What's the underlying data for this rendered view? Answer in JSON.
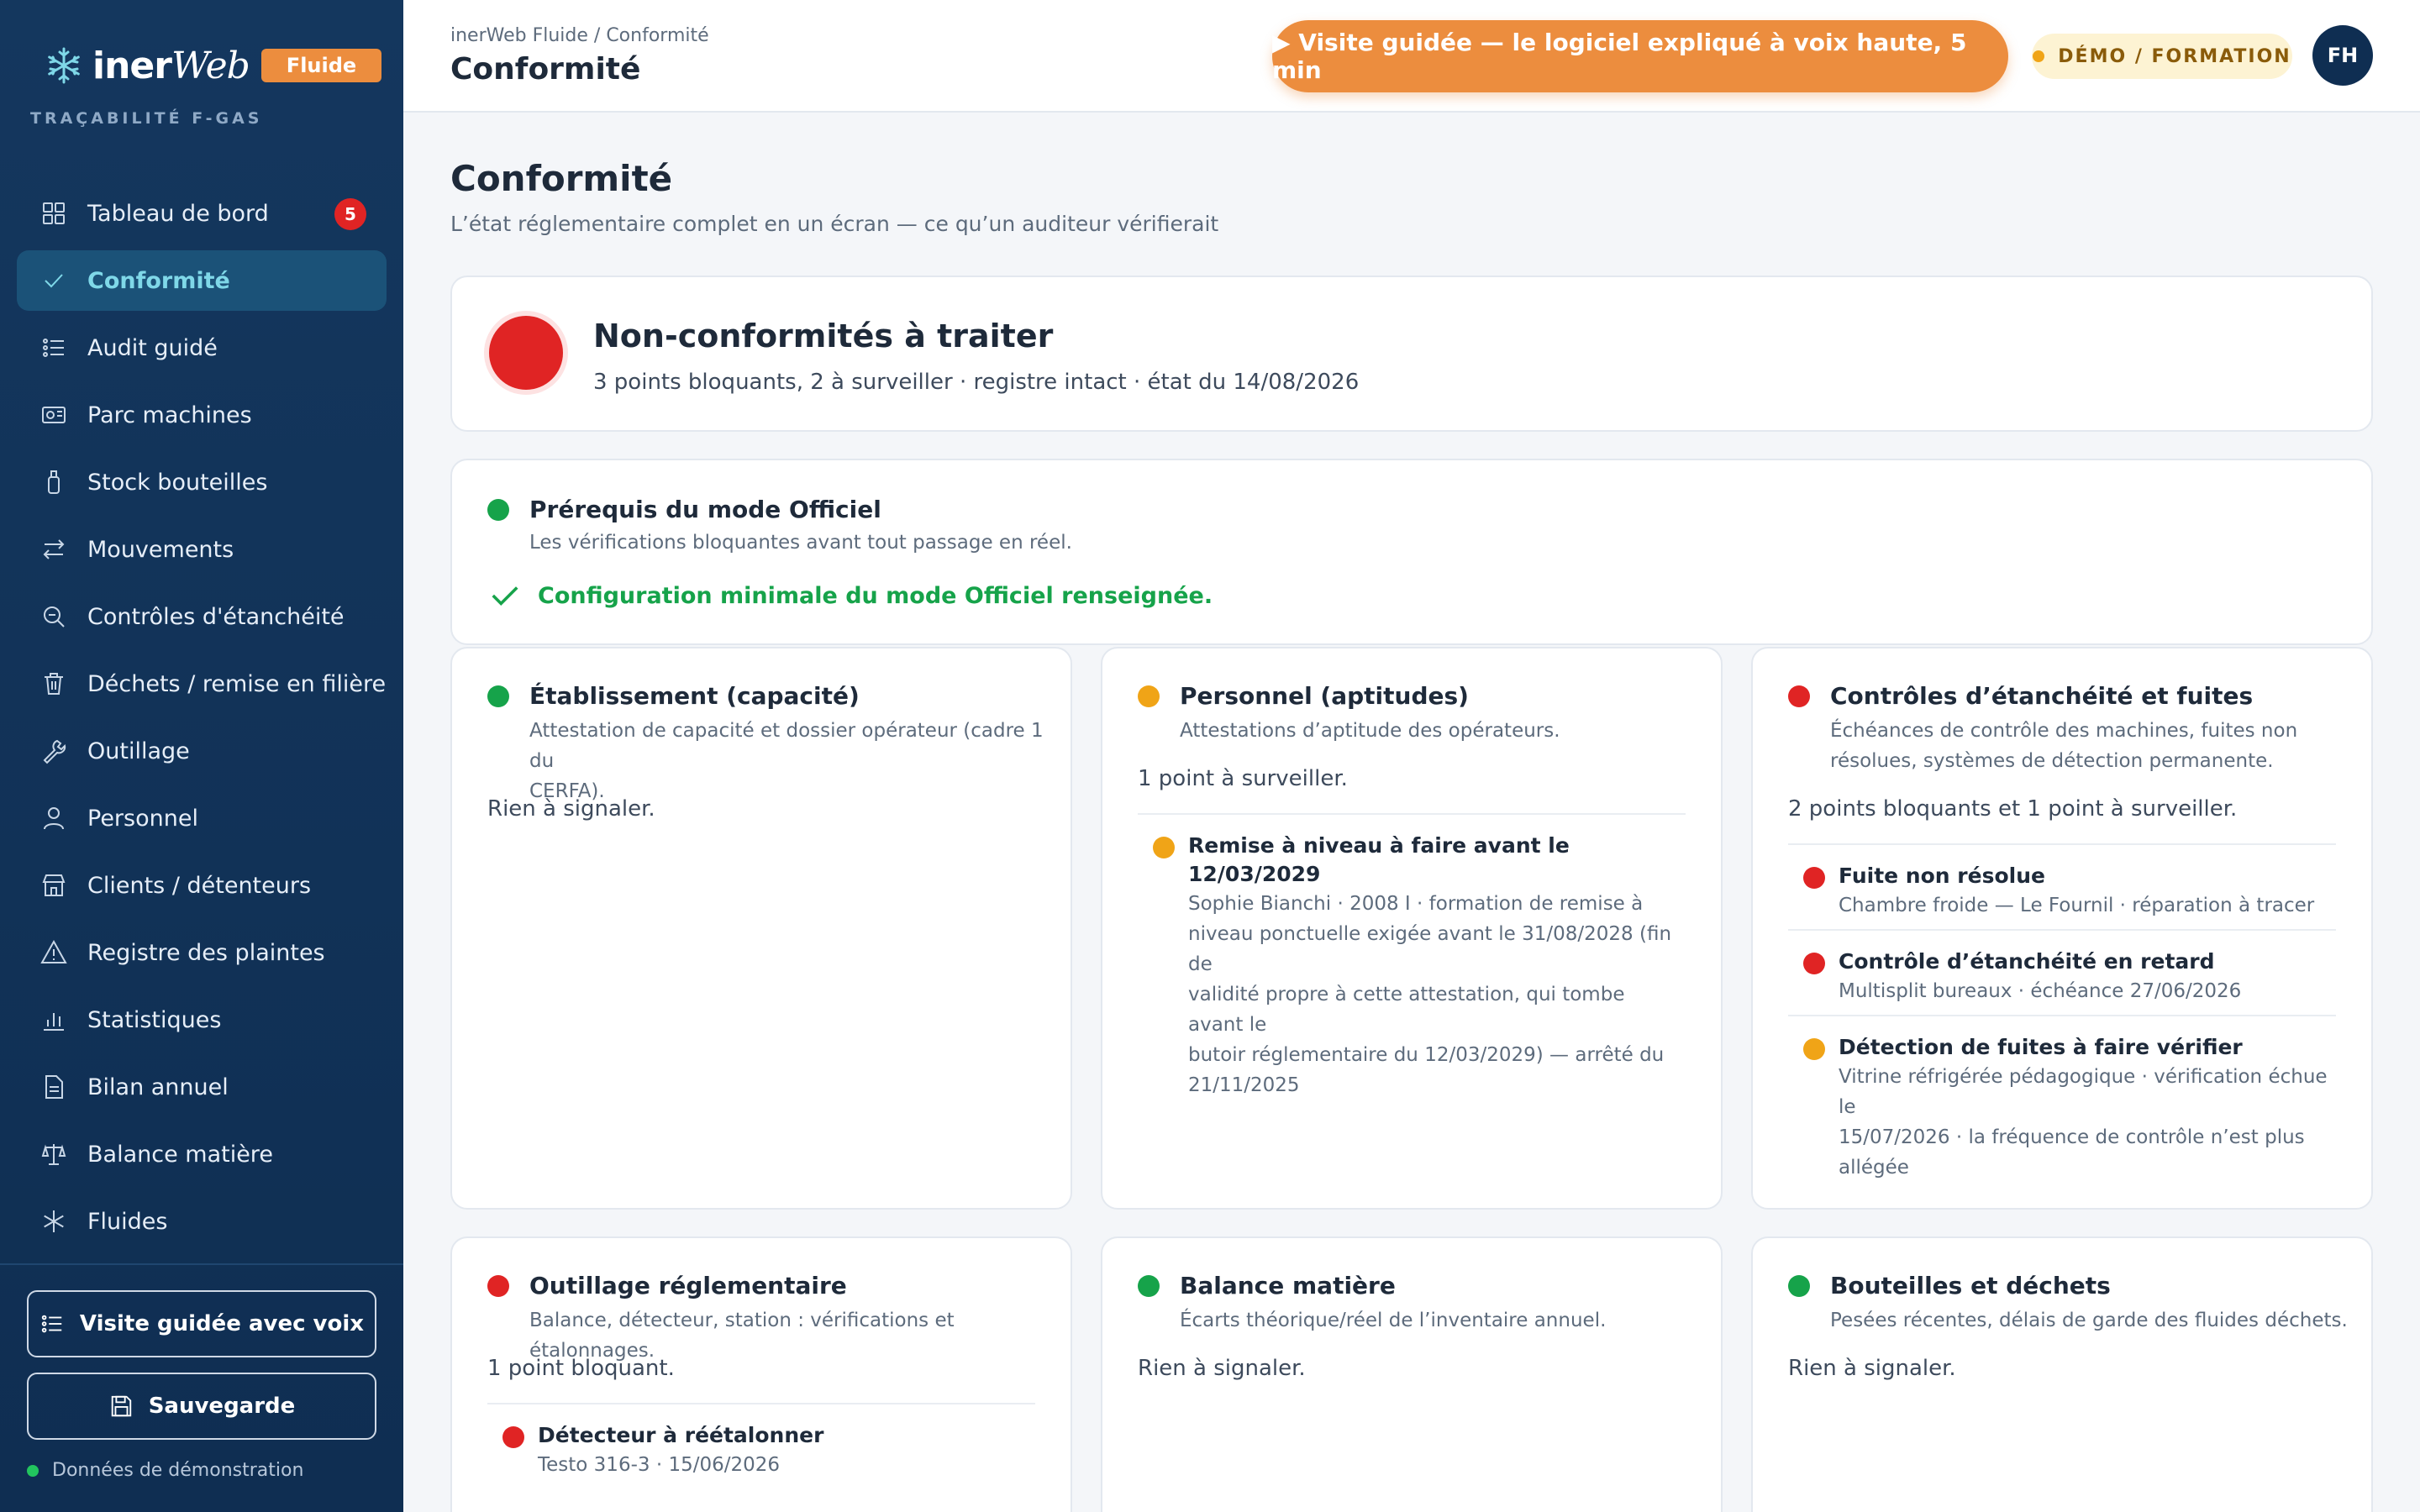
{
  "brand": {
    "name": "inerWeb",
    "tag": "Fluide",
    "subtitle": "TRAÇABILITÉ F-GAS"
  },
  "sidebar": {
    "items": [
      {
        "label": "Tableau de bord",
        "icon": "grid-icon",
        "badge": "5"
      },
      {
        "label": "Conformité",
        "icon": "check-icon",
        "active": true
      },
      {
        "label": "Audit guidé",
        "icon": "list-icon"
      },
      {
        "label": "Parc machines",
        "icon": "machine-icon"
      },
      {
        "label": "Stock bouteilles",
        "icon": "bottle-icon"
      },
      {
        "label": "Mouvements",
        "icon": "arrows-icon"
      },
      {
        "label": "Contrôles d'étanchéité",
        "icon": "search-icon"
      },
      {
        "label": "Déchets / remise en filière",
        "icon": "trash-icon"
      },
      {
        "label": "Outillage",
        "icon": "wrench-icon"
      },
      {
        "label": "Personnel",
        "icon": "user-icon"
      },
      {
        "label": "Clients / détenteurs",
        "icon": "store-icon"
      },
      {
        "label": "Registre des plaintes",
        "icon": "warning-icon"
      },
      {
        "label": "Statistiques",
        "icon": "bar-chart-icon"
      },
      {
        "label": "Bilan annuel",
        "icon": "document-icon"
      },
      {
        "label": "Balance matière",
        "icon": "scale-icon"
      },
      {
        "label": "Fluides",
        "icon": "snowflake-icon"
      }
    ],
    "tour_button": "Visite guidée avec voix",
    "save_button": "Sauvegarde",
    "demo_data": "Données de démonstration"
  },
  "topbar": {
    "breadcrumb": "inerWeb Fluide / Conformité",
    "title": "Conformité",
    "tour_button": "▶ Visite guidée — le logiciel expliqué à voix haute, 5 min",
    "demo_pill": "DÉMO / FORMATION",
    "avatar": "FH"
  },
  "page": {
    "title": "Conformité",
    "subtitle": "L’état réglementaire complet en un écran — ce qu’un auditeur vérifierait"
  },
  "status": {
    "title": "Non-conformités à traiter",
    "subtitle": "3 points bloquants, 2 à surveiller · registre intact · état du 14/08/2026",
    "color": "#e02424"
  },
  "prereq": {
    "title": "Prérequis du mode Officiel",
    "desc": "Les vérifications bloquantes avant tout passage en réel.",
    "ok": "Configuration minimale du mode Officiel renseignée."
  },
  "sections": [
    {
      "title": "Établissement (capacité)",
      "status": "green",
      "desc": [
        "Attestation de capacité et dossier opérateur (cadre 1 du",
        "CERFA)."
      ],
      "summary": "Rien à signaler.",
      "issues": []
    },
    {
      "title": "Personnel (aptitudes)",
      "status": "orange",
      "desc": [
        "Attestations d’aptitude des opérateurs."
      ],
      "summary": "1 point à surveiller.",
      "issues": [
        {
          "status": "orange",
          "title": "Remise à niveau à faire avant le 12/03/2029",
          "desc": [
            "Sophie Bianchi · 2008 I · formation de remise à",
            "niveau ponctuelle exigée avant le 31/08/2028 (fin de",
            "validité propre à cette attestation, qui tombe avant le",
            "butoir réglementaire du 12/03/2029) — arrêté du",
            "21/11/2025"
          ]
        }
      ]
    },
    {
      "title": "Contrôles d’étanchéité et fuites",
      "status": "red",
      "desc": [
        "Échéances de contrôle des machines, fuites non",
        "résolues, systèmes de détection permanente."
      ],
      "summary": "2 points bloquants et 1 point à surveiller.",
      "issues": [
        {
          "status": "red",
          "title": "Fuite non résolue",
          "desc": [
            "Chambre froide — Le Fournil · réparation à tracer"
          ]
        },
        {
          "status": "red",
          "title": "Contrôle d’étanchéité en retard",
          "desc": [
            "Multisplit bureaux · échéance 27/06/2026"
          ]
        },
        {
          "status": "orange",
          "title": "Détection de fuites à faire vérifier",
          "desc": [
            "Vitrine réfrigérée pédagogique · vérification échue le",
            "15/07/2026 · la fréquence de contrôle n’est plus",
            "allégée"
          ]
        }
      ]
    },
    {
      "title": "Outillage réglementaire",
      "status": "red",
      "desc": [
        "Balance, détecteur, station : vérifications et étalonnages."
      ],
      "summary": "1 point bloquant.",
      "issues": [
        {
          "status": "red",
          "title": "Détecteur à réétalonner",
          "desc": [
            "Testo 316-3 · 15/06/2026"
          ]
        }
      ]
    },
    {
      "title": "Balance matière",
      "status": "green",
      "desc": [
        "Écarts théorique/réel de l’inventaire annuel."
      ],
      "summary": "Rien à signaler.",
      "issues": []
    },
    {
      "title": "Bouteilles et déchets",
      "status": "green",
      "desc": [
        "Pesées récentes, délais de garde des fluides déchets."
      ],
      "summary": "Rien à signaler.",
      "issues": []
    }
  ]
}
